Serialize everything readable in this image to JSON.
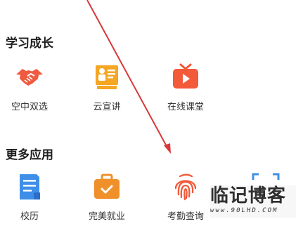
{
  "sections": [
    {
      "title": "学习成长",
      "apps": [
        {
          "label": "空中双选",
          "icon": "handshake-icon",
          "color": "#f05a40"
        },
        {
          "label": "云宣讲",
          "icon": "presentation-board-icon",
          "color": "#f5a623"
        },
        {
          "label": "在线课堂",
          "icon": "video-play-icon",
          "color": "#f25a3a"
        }
      ]
    },
    {
      "title": "更多应用",
      "apps": [
        {
          "label": "校历",
          "icon": "calendar-document-icon",
          "color": "#3f8fe8"
        },
        {
          "label": "完美就业",
          "icon": "briefcase-check-icon",
          "color": "#f0902a"
        },
        {
          "label": "考勤查询",
          "icon": "fingerprint-icon",
          "color": "#f25a3a"
        },
        {
          "label": "",
          "icon": "scan-icon",
          "color": "#3f8fe8"
        }
      ]
    }
  ],
  "annotation": {
    "type": "arrow",
    "color": "#d9383a"
  },
  "watermark": {
    "main": "临记博客",
    "sub": "www.90LHD.COM"
  }
}
